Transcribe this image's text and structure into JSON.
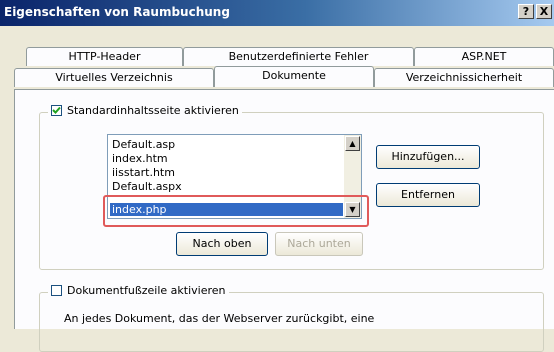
{
  "window": {
    "title": "Eigenschaften von Raumbuchung",
    "help_label": "?",
    "close_label": "X"
  },
  "tabs_back": [
    {
      "label": "HTTP-Header"
    },
    {
      "label": "Benutzerdefinierte Fehler"
    },
    {
      "label": "ASP.NET"
    }
  ],
  "tabs_front": [
    {
      "label": "Virtuelles Verzeichnis"
    },
    {
      "label": "Dokumente",
      "active": true
    },
    {
      "label": "Verzeichnissicherheit"
    }
  ],
  "default_content": {
    "checkbox_label": "Standardinhaltsseite aktivieren",
    "checked": true,
    "documents": [
      "Default.asp",
      "index.htm",
      "iisstart.htm",
      "Default.aspx",
      "index.php"
    ],
    "selected_document": "index.php",
    "add_button": "Hinzufügen...",
    "remove_button": "Entfernen",
    "move_up_button": "Nach oben",
    "move_down_button": "Nach unten"
  },
  "footer": {
    "checkbox_label": "Dokumentfußzeile aktivieren",
    "checked": false,
    "description": "An jedes Dokument, das der Webserver zurückgibt, eine"
  },
  "colors": {
    "selection": "#316ac5",
    "highlight_box": "#e05a5a"
  }
}
